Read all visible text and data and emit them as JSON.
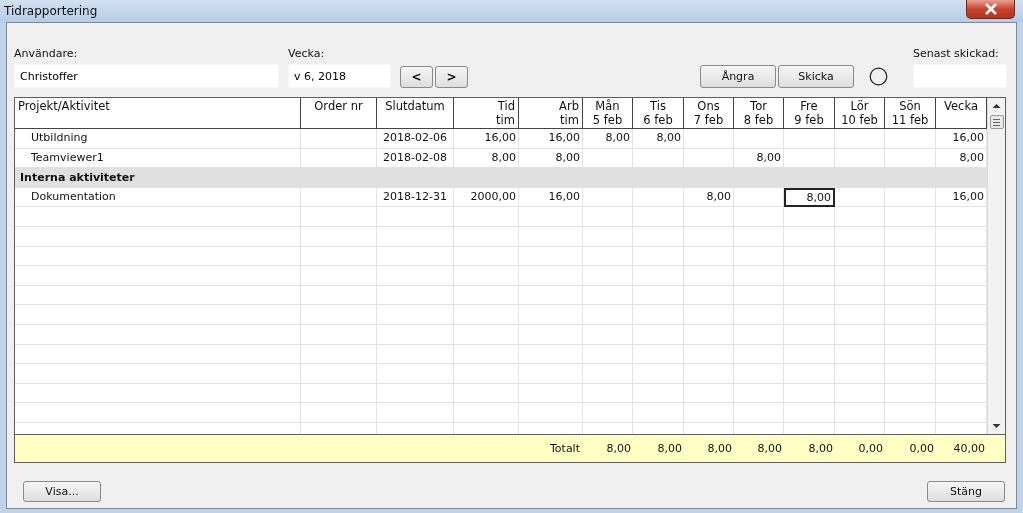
{
  "window": {
    "title": "Tidrapportering"
  },
  "user": {
    "label": "Användare:",
    "value": "Christoffer"
  },
  "week": {
    "label": "Vecka:",
    "value": "v 6, 2018",
    "prev": "<",
    "next": ">"
  },
  "actions": [
    {
      "label": "Ångra"
    },
    {
      "label": "Skicka"
    }
  ],
  "last_sent": {
    "label": "Senast skickad:"
  },
  "table": {
    "columns": [
      {
        "label": "Projekt/Aktivitet"
      },
      {
        "label": "Order nr"
      },
      {
        "label": "Slutdatum"
      },
      {
        "label": "Tid",
        "sub": "tim"
      },
      {
        "label": "Arb",
        "sub": "tim"
      },
      {
        "label": "Mån",
        "sub": "5 feb"
      },
      {
        "label": "Tis",
        "sub": "6 feb"
      },
      {
        "label": "Ons",
        "sub": "7 feb"
      },
      {
        "label": "Tor",
        "sub": "8 feb"
      },
      {
        "label": "Fre",
        "sub": "9 feb"
      },
      {
        "label": "Lör",
        "sub": "10 feb"
      },
      {
        "label": "Sön",
        "sub": "11 feb"
      },
      {
        "label": "Vecka"
      }
    ],
    "rows": [
      {
        "kind": "activity",
        "cells": [
          {
            "text": "Utbildning",
            "selected": false
          },
          {
            "selected": false
          },
          {
            "text": "2018-02-06",
            "selected": false
          },
          {
            "text": "16,00",
            "selected": false
          },
          {
            "text": "16,00",
            "selected": false
          },
          {
            "text": "8,00",
            "selected": false
          },
          {
            "text": "8,00",
            "selected": false
          },
          {
            "selected": false
          },
          {
            "selected": false
          },
          {
            "selected": false
          },
          {
            "selected": false
          },
          {
            "selected": false
          },
          {
            "text": "16,00",
            "selected": false
          }
        ]
      },
      {
        "kind": "activity",
        "cells": [
          {
            "text": "Teamviewer1",
            "selected": false
          },
          {
            "selected": false
          },
          {
            "text": "2018-02-08",
            "selected": false
          },
          {
            "text": "8,00",
            "selected": false
          },
          {
            "text": "8,00",
            "selected": false
          },
          {
            "selected": false
          },
          {
            "selected": false
          },
          {
            "selected": false
          },
          {
            "text": "8,00",
            "selected": false
          },
          {
            "selected": false
          },
          {
            "selected": false
          },
          {
            "selected": false
          },
          {
            "text": "8,00",
            "selected": false
          }
        ]
      },
      {
        "kind": "group",
        "title": "Interna aktiviteter"
      },
      {
        "kind": "activity",
        "cells": [
          {
            "text": "Dokumentation",
            "selected": false
          },
          {
            "selected": false
          },
          {
            "text": "2018-12-31",
            "selected": false
          },
          {
            "text": "2000,00",
            "selected": false
          },
          {
            "text": "16,00",
            "selected": false
          },
          {
            "selected": false
          },
          {
            "selected": false
          },
          {
            "text": "8,00",
            "selected": false
          },
          {
            "selected": false
          },
          {
            "text": "8,00",
            "selected": true
          },
          {
            "selected": false
          },
          {
            "selected": false
          },
          {
            "text": "16,00",
            "selected": false
          }
        ]
      }
    ],
    "totals": {
      "label": "Totalt",
      "values": [
        "8,00",
        "8,00",
        "8,00",
        "8,00",
        "8,00",
        "0,00",
        "0,00",
        "40,00"
      ]
    }
  },
  "buttons": [
    {
      "label": "Visa..."
    },
    {
      "label": "Stäng"
    }
  ]
}
